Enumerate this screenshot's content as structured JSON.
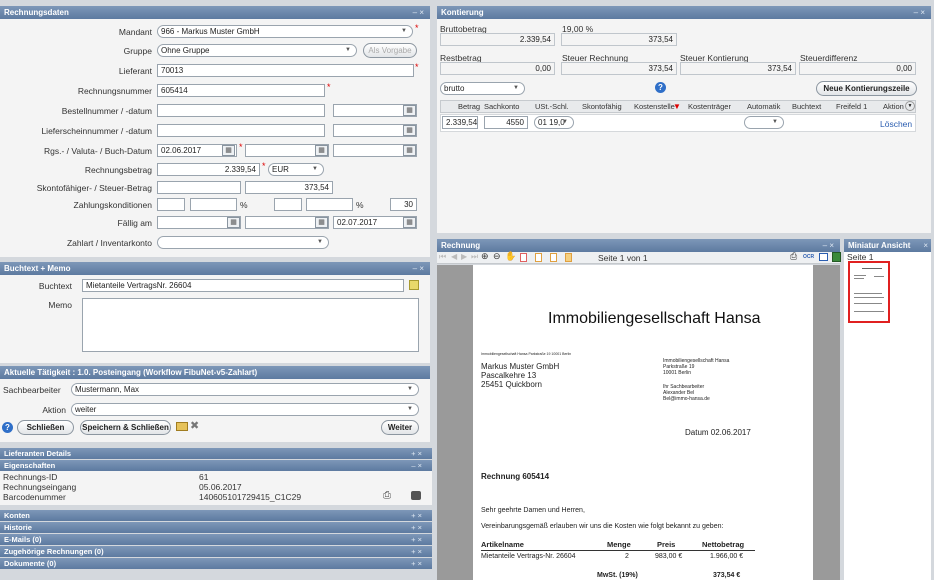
{
  "rech": {
    "title": "Rechnungsdaten",
    "ctl": "– ×",
    "mandant_lbl": "Mandant",
    "mandant": "966 - Markus Muster GmbH",
    "gruppe_lbl": "Gruppe",
    "gruppe": "Ohne Gruppe",
    "vorgabe_btn": "Als Vorgabe",
    "lieferant_lbl": "Lieferant",
    "lieferant": "70013",
    "rnr_lbl": "Rechnungsnummer",
    "rnr": "605414",
    "best_lbl": "Bestellnummer / -datum",
    "liefs_lbl": "Lieferscheinnummer / -datum",
    "rgs_lbl": "Rgs.- / Valuta- / Buch-Datum",
    "rgs_date": "02.06.2017",
    "betrag_lbl": "Rechnungsbetrag",
    "betrag": "2.339,54",
    "currency": "EUR",
    "skonto_lbl": "Skontofähiger- / Steuer-Betrag",
    "steuer": "373,54",
    "zahl_lbl": "Zahlungskonditionen",
    "pct1": "%",
    "pct2": "%",
    "days": "30",
    "faellig_lbl": "Fällig am",
    "faellig": "02.07.2017",
    "zahlart_lbl": "Zahlart / Inventarkonto"
  },
  "memo": {
    "title": "Buchtext + Memo",
    "ctl": "– ×",
    "buchtext_lbl": "Buchtext",
    "buchtext": "Mietanteile VertragsNr. 26604",
    "memo_lbl": "Memo"
  },
  "task": {
    "title": "Aktuelle Tätigkeit : 1.0. Posteingang (Workflow FibuNet-v5-Zahlart)",
    "sb_lbl": "Sachbearbeiter",
    "sb": "Mustermann, Max",
    "aktion_lbl": "Aktion",
    "aktion": "weiter",
    "close_btn": "Schließen",
    "save_btn": "Speichern & Schließen",
    "next_btn": "Weiter"
  },
  "sections": {
    "lief": "Lieferanten Details",
    "eig": "Eigenschaften",
    "konten": "Konten",
    "historie": "Historie",
    "emails": "E-Mails (0)",
    "zug": "Zugehörige Rechnungen (0)",
    "dok": "Dokumente (0)",
    "plus": "+ ×",
    "minus": "– ×"
  },
  "props": {
    "id_lbl": "Rechnungs-ID",
    "id": "61",
    "eing_lbl": "Rechnungseingang",
    "eing": "05.06.2017",
    "bc_lbl": "Barcodenummer",
    "bc": "140605101729415_C1C29"
  },
  "kont": {
    "title": "Kontierung",
    "ctl": "– ×",
    "brutto_lbl": "Bruttobetrag",
    "brutto": "2.339,54",
    "pct": "19,00 %",
    "steuer": "373,54",
    "rest_lbl": "Restbetrag",
    "rest": "0,00",
    "sr_lbl": "Steuer Rechnung",
    "sr": "373,54",
    "sk_lbl": "Steuer Kontierung",
    "sk": "373,54",
    "sd_lbl": "Steuerdifferenz",
    "sd": "0,00",
    "mode": "brutto",
    "neu_btn": "Neue Kontierungszeile",
    "cols": [
      "Betrag",
      "Sachkonto",
      "USt.-Schl.",
      "Skontofähig",
      "Kostenstelle",
      "Kostenträger",
      "Automatik",
      "Buchtext",
      "Freifeld 1",
      "Aktion"
    ],
    "row": {
      "betrag": "2.339,54",
      "konto": "4550",
      "ust": "01 19,0",
      "action": "Löschen"
    }
  },
  "viewer": {
    "title": "Rechnung",
    "ctl": "– ×",
    "page": "Seite 1 von 1",
    "ocr": "OCR"
  },
  "mini": {
    "title": "Miniatur Ansicht",
    "ctl": "×",
    "page": "Seite 1"
  },
  "doc": {
    "company": "Immobiliengesellschaft Hansa",
    "sender_line": "Immobiliengesellschaft Hansa Parkstraße 19 10001 Berlin",
    "rcpt": [
      "Markus Muster GmbH",
      "Pascalkehre 13",
      "25451 Quickborn"
    ],
    "from": [
      "Immobiliengesellschaft Hansa",
      "Parkstraße 19",
      "10001 Berlin"
    ],
    "contact": [
      "Ihr Sachbearbeiter",
      "Alexander Bel",
      "Bel@immo-hansa.de"
    ],
    "date": "Datum 02.06.2017",
    "subject": "Rechnung 605414",
    "salutation": "Sehr geehrte Damen und Herren,",
    "intro": "Vereinbarungsgemäß erlauben wir uns die Kosten wie folgt bekannt zu geben:",
    "th": [
      "Artikelname",
      "Menge",
      "Preis",
      "Nettobetrag"
    ],
    "row": [
      "Mietanteile Vertrags-Nr. 26604",
      "2",
      "983,00 €",
      "1.966,00 €"
    ],
    "mwst_lbl": "MwSt. (19%)",
    "mwst": "373,54 €"
  }
}
